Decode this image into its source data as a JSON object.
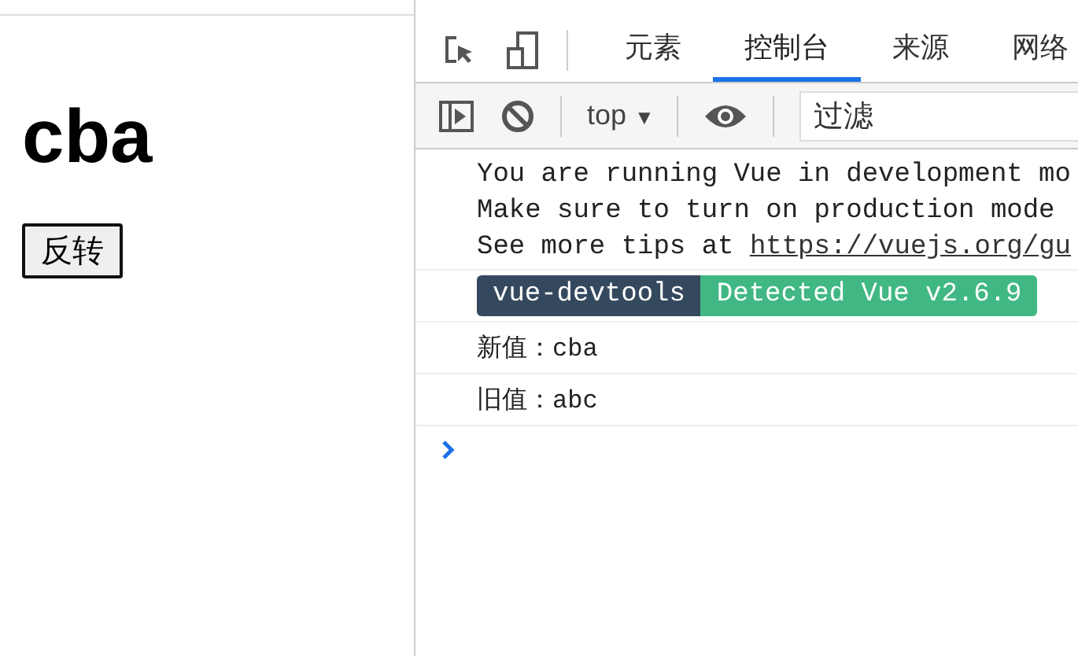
{
  "page": {
    "heading": "cba",
    "button": "反转"
  },
  "devtools": {
    "tabs": [
      {
        "label": "元素",
        "selected": false
      },
      {
        "label": "控制台",
        "selected": true
      },
      {
        "label": "来源",
        "selected": false
      },
      {
        "label": "网络",
        "selected": false
      }
    ],
    "toolbar": {
      "context": "top",
      "context_caret": "▼",
      "filter": {
        "placeholder": "过滤"
      }
    },
    "console": {
      "warning_lines": [
        {
          "text": "You are running Vue in development mo"
        },
        {
          "text": "Make sure to turn on production mode"
        },
        {
          "text": "See more tips at ",
          "link": "https://vuejs.org/gu"
        }
      ],
      "badge": [
        {
          "text": "vue-devtools",
          "color": "#35495e"
        },
        {
          "text": "Detected Vue v2.6.9",
          "color": "#41b883"
        }
      ],
      "logs": [
        "新值：cba",
        "旧值：abc"
      ]
    }
  }
}
